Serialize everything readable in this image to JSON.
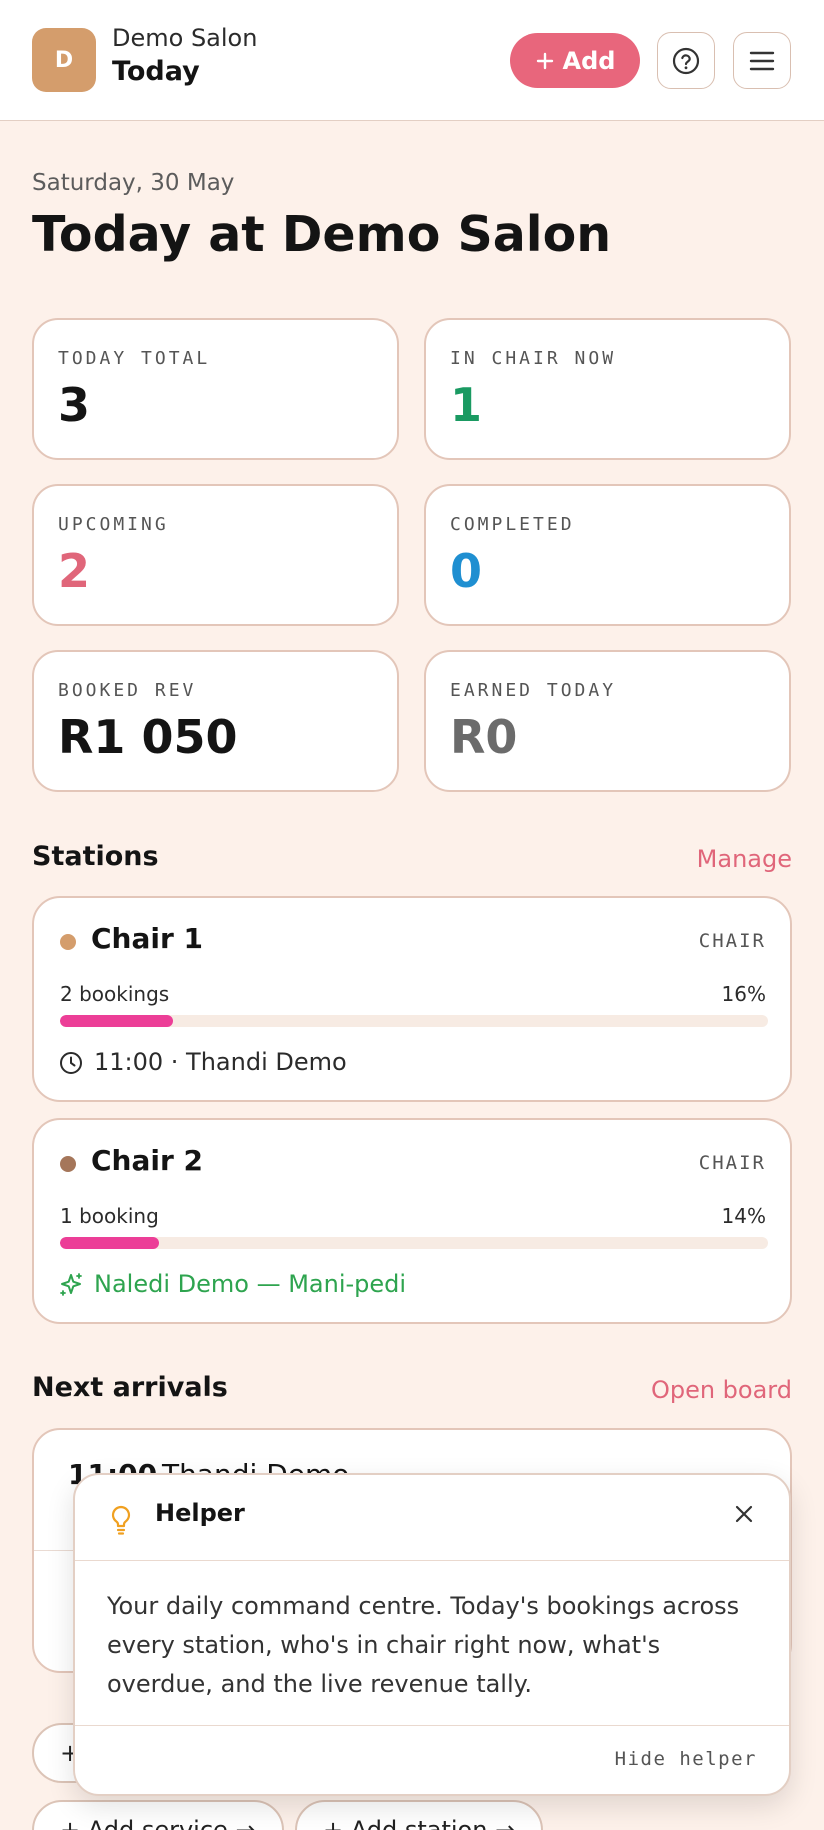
{
  "header": {
    "avatar_letter": "D",
    "salon_name": "Demo Salon",
    "page_name": "Today",
    "add_label": "Add"
  },
  "intro": {
    "date": "Saturday, 30 May",
    "title": "Today at Demo Salon"
  },
  "stats": [
    {
      "label": "TODAY TOTAL",
      "value": "3",
      "color": "#141414"
    },
    {
      "label": "IN CHAIR NOW",
      "value": "1",
      "color": "#1a9a62"
    },
    {
      "label": "UPCOMING",
      "value": "2",
      "color": "#e0667a"
    },
    {
      "label": "COMPLETED",
      "value": "0",
      "color": "#1f8fd1"
    },
    {
      "label": "BOOKED REV",
      "value": "R1 050",
      "color": "#141414"
    },
    {
      "label": "EARNED TODAY",
      "value": "R0",
      "color": "#6b6b6b"
    }
  ],
  "stations": {
    "title": "Stations",
    "manage_label": "Manage",
    "items": [
      {
        "name": "Chair 1",
        "type": "CHAIR",
        "dot_color": "#d49d6c",
        "count": "2 bookings",
        "pct": "16%",
        "fill": 0.16,
        "icon": "clock-icon",
        "detail": "11:00 · Thandi Demo",
        "detail_color": "#2b2b2b"
      },
      {
        "name": "Chair 2",
        "type": "CHAIR",
        "dot_color": "#a5765a",
        "count": "1 booking",
        "pct": "14%",
        "fill": 0.14,
        "icon": "sparkle-icon",
        "detail": "Naledi Demo — Mani-pedi",
        "detail_color": "#2ea44f"
      }
    ]
  },
  "arrivals": {
    "title": "Next arrivals",
    "link_label": "Open board",
    "first_time": "11:00",
    "first_name": "Thandi Demo"
  },
  "quick_actions": {
    "add_service": "Add service",
    "add_station": "Add station"
  },
  "helper": {
    "title": "Helper",
    "body": "Your daily command centre. Today's bookings across every station, who's in chair right now, what's overdue, and the live revenue tally.",
    "hide_label": "Hide helper"
  },
  "colors": {
    "accent": "#e8667c",
    "background": "#fdf1ea",
    "bar_fill": "#ec3e97"
  }
}
